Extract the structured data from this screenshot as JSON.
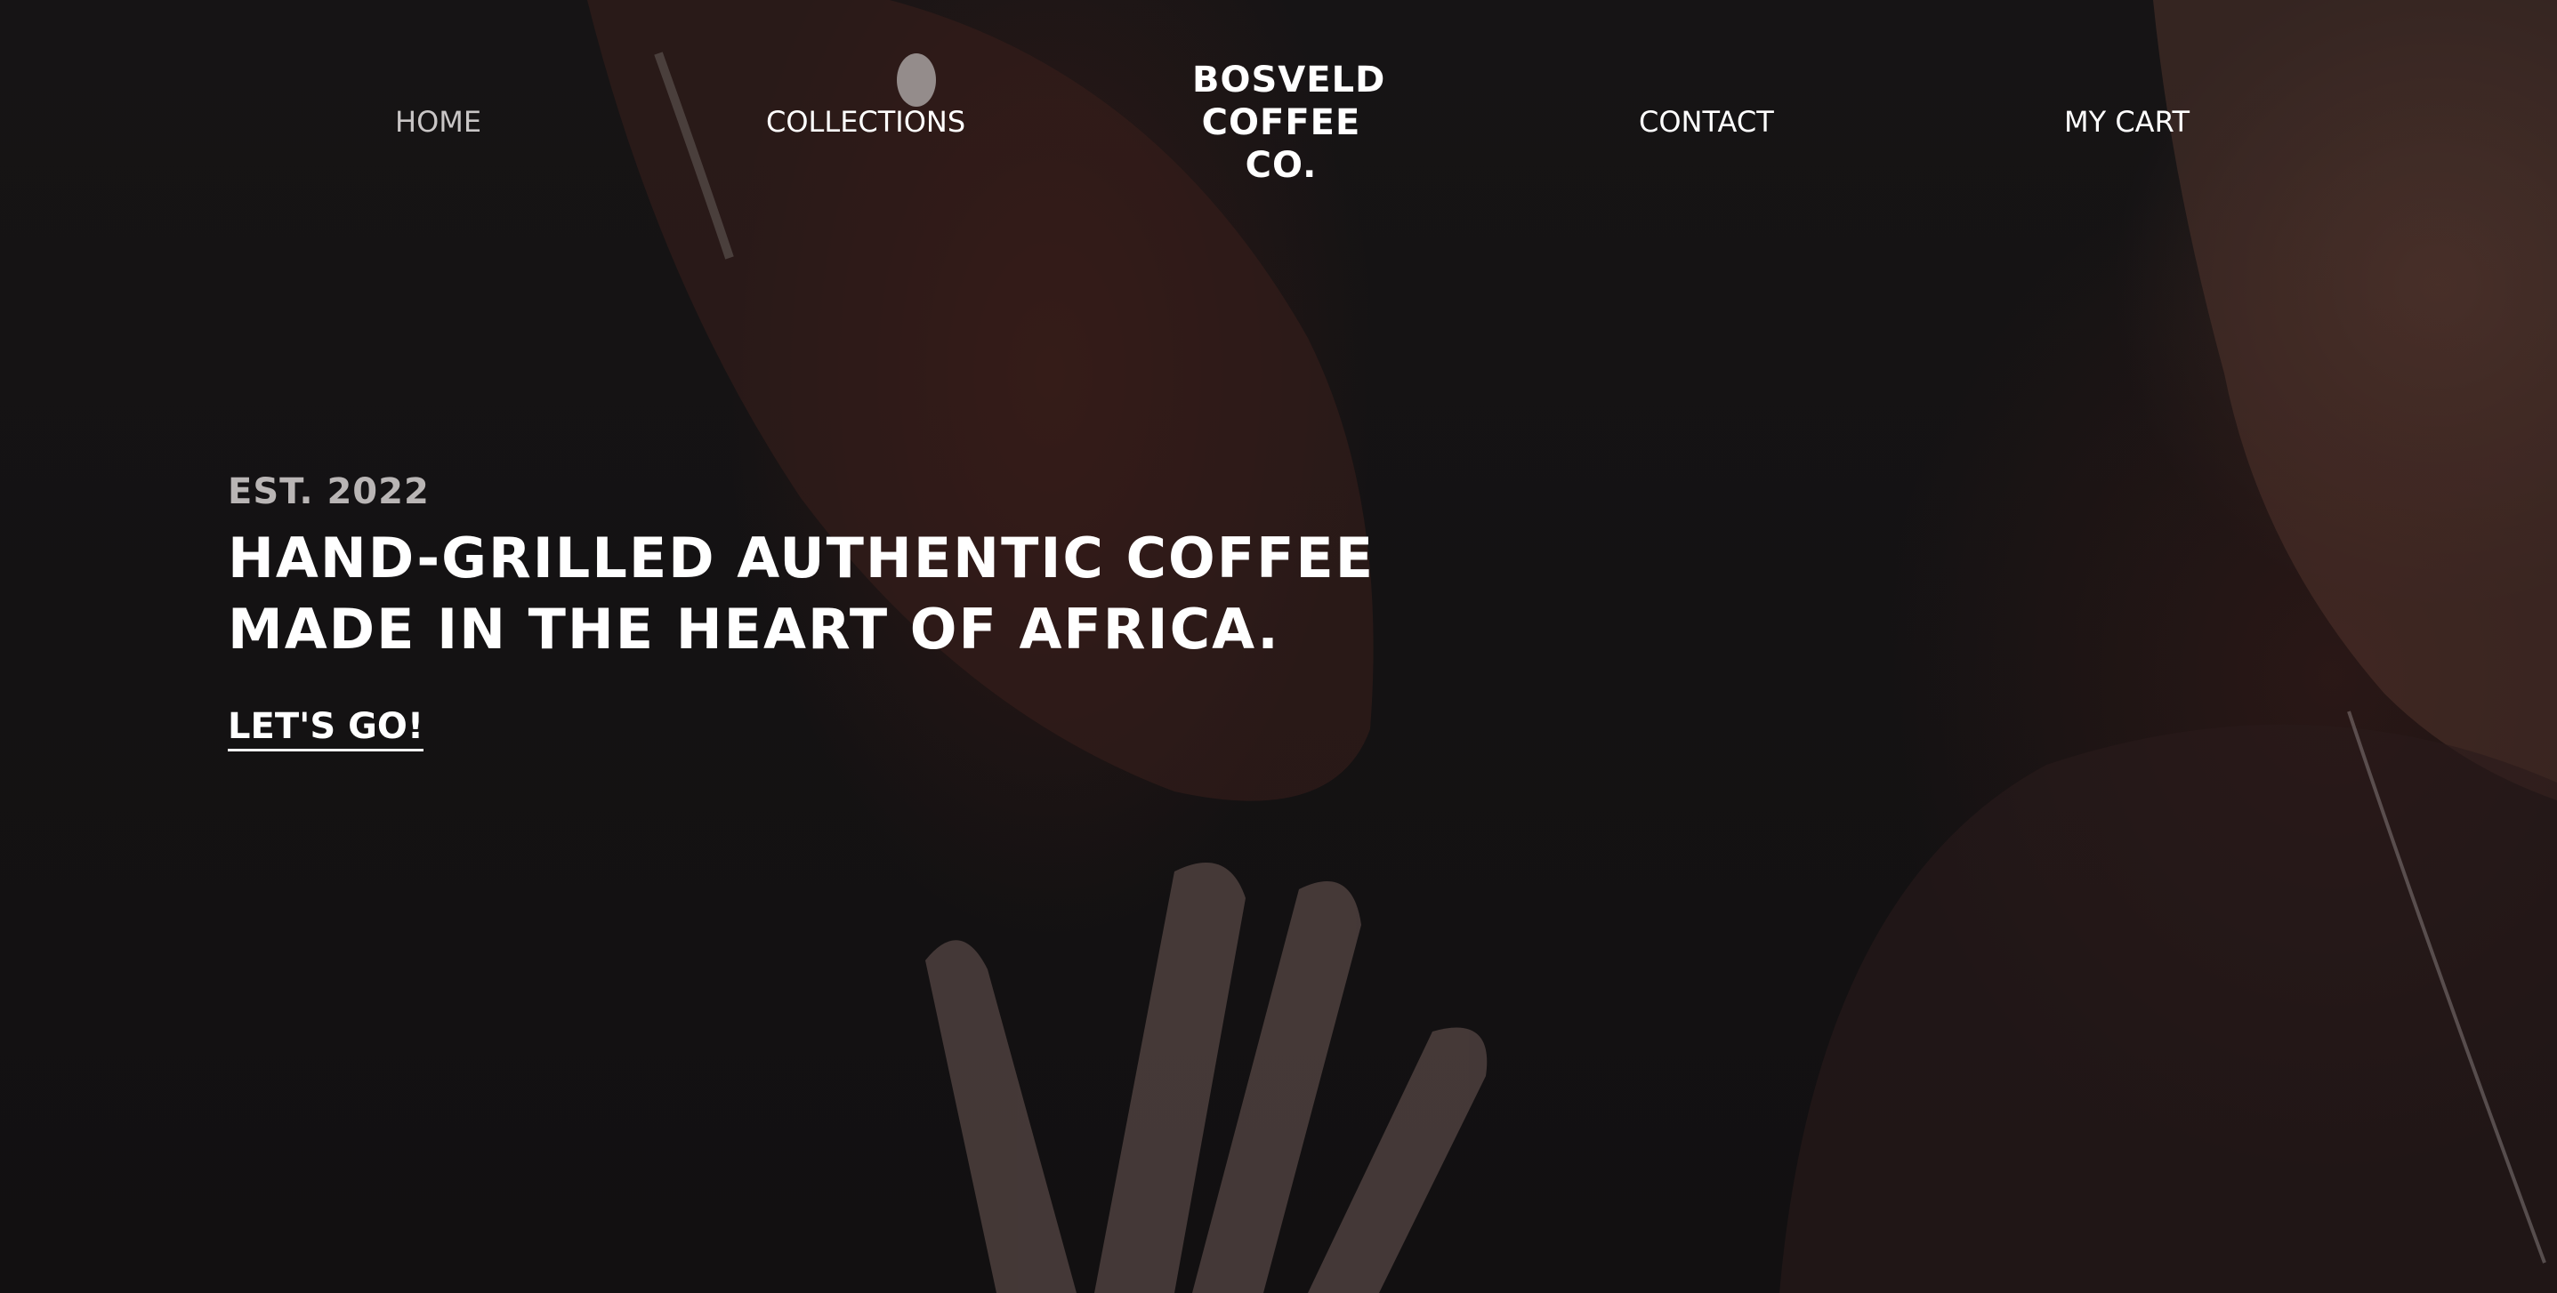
{
  "nav": {
    "home_label": "HOME",
    "collections_label": "COLLECTIONS",
    "contact_label": "CONTACT",
    "cart_label": "MY CART"
  },
  "logo": {
    "line1": "BOSVELD",
    "line2": "COFFEE",
    "line3": "CO."
  },
  "hero": {
    "established": "EST. 2022",
    "headline_line1": "HAND-GRILLED AUTHENTIC COFFEE",
    "headline_line2": "MADE IN THE HEART OF AFRICA.",
    "cta_label": "LET'S GO!"
  },
  "colors": {
    "background": "#141213",
    "text": "#ffffff",
    "muted_text": "#b9b5b5",
    "active_nav": "#c9c6c6"
  }
}
